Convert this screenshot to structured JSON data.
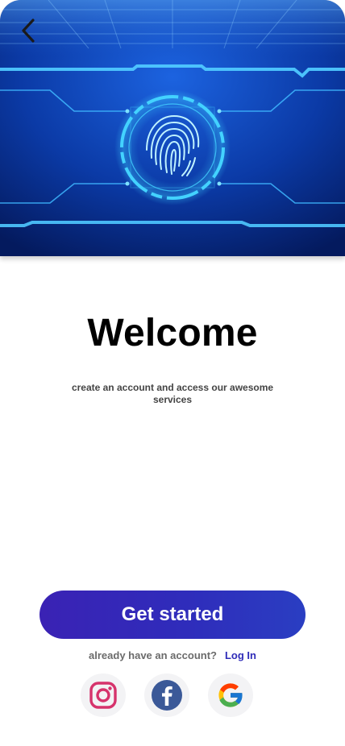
{
  "header": {
    "back_icon": "chevron-left-icon",
    "hero_image": "fingerprint-scan-illustration"
  },
  "welcome": {
    "title": "Welcome",
    "subtitle": "create an account and access our awesome services"
  },
  "actions": {
    "get_started_label": "Get started",
    "login_prompt": "already have an account?",
    "login_label": "Log In"
  },
  "social": [
    {
      "icon": "instagram-icon",
      "color": "#d6336c"
    },
    {
      "icon": "facebook-icon",
      "color": "#3b5998"
    },
    {
      "icon": "google-icon",
      "color": "#4285f4"
    }
  ],
  "colors": {
    "accent": "#2f2cb8",
    "hero_dark": "#031a5c",
    "hero_glow": "#3fd4ff"
  }
}
